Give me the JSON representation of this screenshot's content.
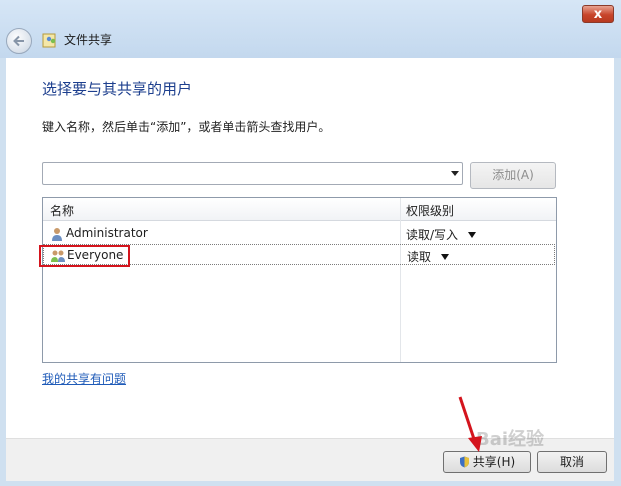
{
  "window": {
    "title": "文件共享",
    "close_label": "x"
  },
  "main": {
    "heading": "选择要与其共享的用户",
    "instruction": "键入名称，然后单击“添加”，或者单击箭头查找用户。",
    "name_input_value": "",
    "add_button": "添加(A)",
    "problem_link": "我的共享有问题"
  },
  "list": {
    "columns": [
      "名称",
      "权限级别"
    ],
    "rows": [
      {
        "name": "Administrator",
        "permission": "读取/写入",
        "icon": "user-icon"
      },
      {
        "name": "Everyone",
        "permission": "读取",
        "icon": "group-users-icon"
      }
    ]
  },
  "footer": {
    "share_button": "共享(H)",
    "cancel_button": "取消"
  },
  "watermark": "Bai经验",
  "colors": {
    "heading": "#1d3f8e",
    "link": "#1f5bb8",
    "highlight_box": "#d4141d",
    "annotation_arrow": "#d4141d"
  }
}
